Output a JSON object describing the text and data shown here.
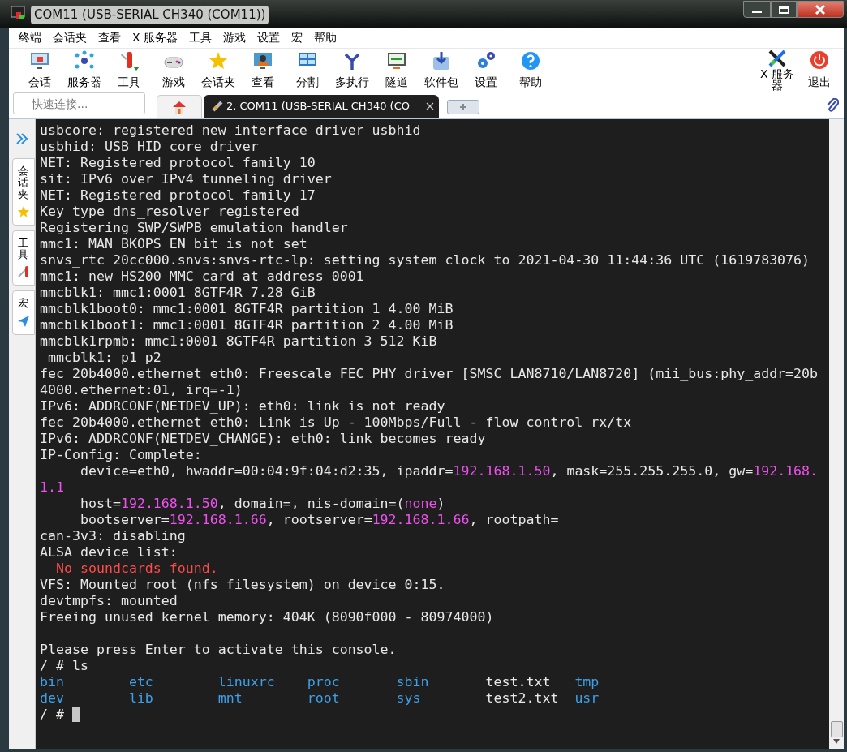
{
  "window": {
    "title": "COM11  (USB-SERIAL CH340 (COM11))"
  },
  "menu": [
    "终端",
    "会话夹",
    "查看",
    "X 服务器",
    "工具",
    "游戏",
    "设置",
    "宏",
    "帮助"
  ],
  "toolbar": {
    "left": [
      "会话",
      "服务器",
      "工具",
      "游戏",
      "会话夹",
      "查看",
      "分割",
      "多执行",
      "隧道",
      "软件包",
      "设置",
      "帮助"
    ],
    "right": [
      "X 服务器",
      "退出"
    ]
  },
  "quick_connect": {
    "placeholder": "快速连接..."
  },
  "tabs": [
    {
      "kind": "home",
      "selected": false
    },
    {
      "kind": "session",
      "label": "2. COM11  (USB-SERIAL CH340 (CO",
      "selected": true
    },
    {
      "kind": "new",
      "selected": false
    }
  ],
  "side_panel": [
    "会话夹",
    "工具",
    "宏"
  ],
  "terminal": {
    "cursor": true,
    "lines": [
      [
        {
          "kind": "plain",
          "text": "usbcore: registered new interface driver usbhid"
        }
      ],
      [
        {
          "kind": "plain",
          "text": "usbhid: USB HID core driver"
        }
      ],
      [
        {
          "kind": "plain",
          "text": "NET: Registered protocol family 10"
        }
      ],
      [
        {
          "kind": "plain",
          "text": "sit: IPv6 over IPv4 tunneling driver"
        }
      ],
      [
        {
          "kind": "plain",
          "text": "NET: Registered protocol family 17"
        }
      ],
      [
        {
          "kind": "plain",
          "text": "Key type dns_resolver registered"
        }
      ],
      [
        {
          "kind": "plain",
          "text": "Registering SWP/SWPB emulation handler"
        }
      ],
      [
        {
          "kind": "plain",
          "text": "mmc1: MAN_BKOPS_EN bit is not set"
        }
      ],
      [
        {
          "kind": "plain",
          "text": "snvs_rtc 20cc000.snvs:snvs-rtc-lp: setting system clock to 2021-04-30 11:44:36 UTC (1619783076)"
        }
      ],
      [
        {
          "kind": "plain",
          "text": "mmc1: new HS200 MMC card at address 0001"
        }
      ],
      [
        {
          "kind": "plain",
          "text": "mmcblk1: mmc1:0001 8GTF4R 7.28 GiB"
        }
      ],
      [
        {
          "kind": "plain",
          "text": "mmcblk1boot0: mmc1:0001 8GTF4R partition 1 4.00 MiB"
        }
      ],
      [
        {
          "kind": "plain",
          "text": "mmcblk1boot1: mmc1:0001 8GTF4R partition 2 4.00 MiB"
        }
      ],
      [
        {
          "kind": "plain",
          "text": "mmcblk1rpmb: mmc1:0001 8GTF4R partition 3 512 KiB"
        }
      ],
      [
        {
          "kind": "plain",
          "text": " mmcblk1: p1 p2"
        }
      ],
      [
        {
          "kind": "plain",
          "text": "fec 20b4000.ethernet eth0: Freescale FEC PHY driver [SMSC LAN8710/LAN8720] (mii_bus:phy_addr=20b"
        }
      ],
      [
        {
          "kind": "plain",
          "text": "4000.ethernet:01, irq=-1)"
        }
      ],
      [
        {
          "kind": "plain",
          "text": "IPv6: ADDRCONF(NETDEV_UP): eth0: link is not ready"
        }
      ],
      [
        {
          "kind": "plain",
          "text": "fec 20b4000.ethernet eth0: Link is Up - 100Mbps/Full - flow control rx/tx"
        }
      ],
      [
        {
          "kind": "plain",
          "text": "IPv6: ADDRCONF(NETDEV_CHANGE): eth0: link becomes ready"
        }
      ],
      [
        {
          "kind": "plain",
          "text": "IP-Config: Complete:"
        }
      ],
      [
        {
          "kind": "plain",
          "text": "     device=eth0, hwaddr=00:04:9f:04:d2:35, ipaddr="
        },
        {
          "kind": "ip",
          "text": "192.168.1.50"
        },
        {
          "kind": "plain",
          "text": ", mask=255.255.255.0, gw="
        },
        {
          "kind": "ip",
          "text": "192.168."
        }
      ],
      [
        {
          "kind": "ip",
          "text": "1.1"
        }
      ],
      [
        {
          "kind": "plain",
          "text": "     host="
        },
        {
          "kind": "ip",
          "text": "192.168.1.50"
        },
        {
          "kind": "plain",
          "text": ", domain=, nis-domain=("
        },
        {
          "kind": "ip",
          "text": "none"
        },
        {
          "kind": "plain",
          "text": ")"
        }
      ],
      [
        {
          "kind": "plain",
          "text": "     bootserver="
        },
        {
          "kind": "ip",
          "text": "192.168.1.66"
        },
        {
          "kind": "plain",
          "text": ", rootserver="
        },
        {
          "kind": "ip",
          "text": "192.168.1.66"
        },
        {
          "kind": "plain",
          "text": ", rootpath="
        }
      ],
      [
        {
          "kind": "plain",
          "text": "can-3v3: disabling"
        }
      ],
      [
        {
          "kind": "plain",
          "text": "ALSA device list:"
        }
      ],
      [
        {
          "kind": "error",
          "text": "  No soundcards found."
        }
      ],
      [
        {
          "kind": "plain",
          "text": "VFS: Mounted root (nfs filesystem) on device 0:15."
        }
      ],
      [
        {
          "kind": "plain",
          "text": "devtmpfs: mounted"
        }
      ],
      [
        {
          "kind": "plain",
          "text": "Freeing unused kernel memory: 404K (8090f000 - 80974000)"
        }
      ],
      [
        {
          "kind": "blank"
        }
      ],
      [
        {
          "kind": "plain",
          "text": "Please press Enter to activate this console."
        }
      ],
      [
        {
          "kind": "plain",
          "text": "/ # ls"
        }
      ],
      [
        {
          "kind": "dir",
          "text": "bin        etc        linuxrc    proc       sbin       "
        },
        {
          "kind": "plain",
          "text": "test.txt   "
        },
        {
          "kind": "dir",
          "text": "tmp"
        }
      ],
      [
        {
          "kind": "dir",
          "text": "dev        lib        mnt        root       sys        "
        },
        {
          "kind": "plain",
          "text": "test2.txt  "
        },
        {
          "kind": "dir",
          "text": "usr"
        }
      ],
      [
        {
          "kind": "plain",
          "text": "/ # "
        }
      ]
    ]
  }
}
